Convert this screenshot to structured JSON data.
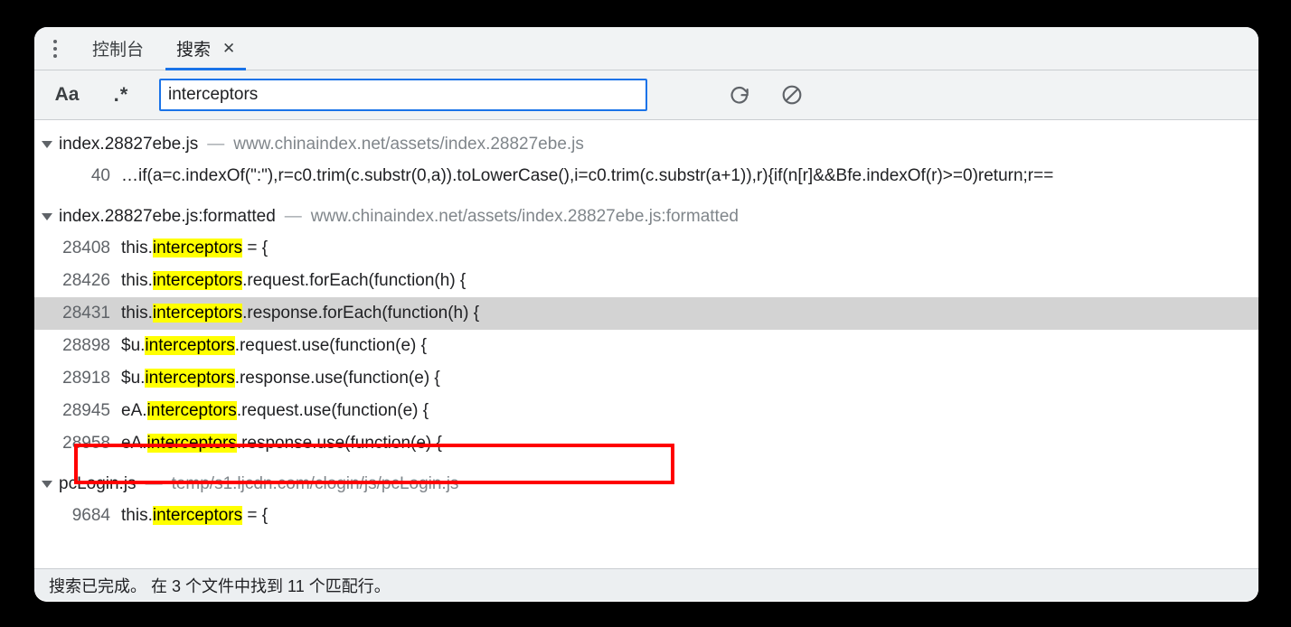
{
  "tabstrip": {
    "menu_icon": "kebab-menu-icon",
    "tabs": [
      {
        "label": "控制台",
        "active": false,
        "closable": false
      },
      {
        "label": "搜索",
        "active": true,
        "closable": true,
        "close_label": "✕"
      }
    ]
  },
  "toolbar": {
    "match_case_label": "Aa",
    "regex_label": ".*",
    "search_value": "interceptors",
    "search_placeholder": "",
    "refresh_icon": "refresh-icon",
    "clear_icon": "clear-icon"
  },
  "results": {
    "query": "interceptors",
    "groups": [
      {
        "name": "index.28827ebe.js",
        "dash": "—",
        "url": "www.chinaindex.net/assets/index.28827ebe.js",
        "expanded": true,
        "rows": [
          {
            "lineno": "40",
            "pre": "…if(a=c.indexOf(\":\"),r=c0.trim(c.substr(0,a)).toLowerCase(),i=c0.trim(c.substr(a+1)),r){if(n[r]&&Bfe.indexOf(r)>=0)return;r==",
            "match": "",
            "post": "",
            "selected": false
          }
        ]
      },
      {
        "name": "index.28827ebe.js:formatted",
        "dash": "—",
        "url": "www.chinaindex.net/assets/index.28827ebe.js:formatted",
        "expanded": true,
        "rows": [
          {
            "lineno": "28408",
            "pre": "this.",
            "match": "interceptors",
            "post": " = {",
            "selected": false
          },
          {
            "lineno": "28426",
            "pre": "this.",
            "match": "interceptors",
            "post": ".request.forEach(function(h) {",
            "selected": false
          },
          {
            "lineno": "28431",
            "pre": "this.",
            "match": "interceptors",
            "post": ".response.forEach(function(h) {",
            "selected": true
          },
          {
            "lineno": "28898",
            "pre": "$u.",
            "match": "interceptors",
            "post": ".request.use(function(e) {",
            "selected": false
          },
          {
            "lineno": "28918",
            "pre": "$u.",
            "match": "interceptors",
            "post": ".response.use(function(e) {",
            "selected": false
          },
          {
            "lineno": "28945",
            "pre": "eA.",
            "match": "interceptors",
            "post": ".request.use(function(e) {",
            "selected": false
          },
          {
            "lineno": "28958",
            "pre": "eA.",
            "match": "interceptors",
            "post": ".response.use(function(e) {",
            "selected": false
          }
        ]
      },
      {
        "name": "pcLogin.js",
        "dash": "—",
        "url": "temp/s1.ljcdn.com/clogin/js/pcLogin.js",
        "expanded": true,
        "rows": [
          {
            "lineno": "9684",
            "pre": "this.",
            "match": "interceptors",
            "post": " = {",
            "selected": false
          }
        ]
      }
    ]
  },
  "status_bar": {
    "text": "搜索已完成。 在 3 个文件中找到 11 个匹配行。"
  },
  "colors": {
    "accent": "#1a73e8",
    "highlight": "#ffff00",
    "annotation": "#ff0000",
    "selected_row": "#d3d3d3",
    "toolbar_bg": "#f1f3f4",
    "status_bg": "#eceff1"
  }
}
